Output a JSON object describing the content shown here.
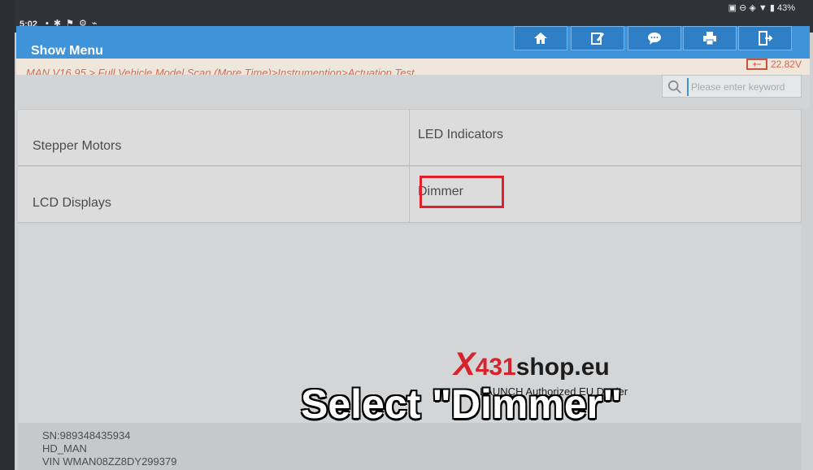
{
  "status": {
    "time": "5:02",
    "battery": "43%"
  },
  "header": {
    "title": "Show Menu",
    "toolbar": [
      {
        "name": "home-icon"
      },
      {
        "name": "edit-icon"
      },
      {
        "name": "message-icon"
      },
      {
        "name": "print-icon"
      },
      {
        "name": "exit-icon"
      }
    ]
  },
  "breadcrumb": "MAN V16.95 > Full Vehicle Model Scan (More Time)>Instrumention>Actuation Test",
  "battery_voltage": "22.82V",
  "search": {
    "placeholder": "Please enter keyword"
  },
  "menu": {
    "items": [
      "Stepper Motors",
      "LED Indicators",
      "LCD Displays",
      "Dimmer"
    ]
  },
  "footer": {
    "sn": "SN:989348435934",
    "model": "HD_MAN",
    "vin": "VIN WMAN08ZZ8DY299379"
  },
  "overlay": {
    "caption": "Select \"Dimmer\"",
    "watermark_x": "X",
    "watermark_num": "431",
    "watermark_shop": "shop.eu",
    "watermark_sub": "LAUNCH Authorized EU Dealer"
  },
  "colors": {
    "header": "#3f93d8",
    "breadcrumb": "#d86a52",
    "highlight": "#e0202b"
  }
}
